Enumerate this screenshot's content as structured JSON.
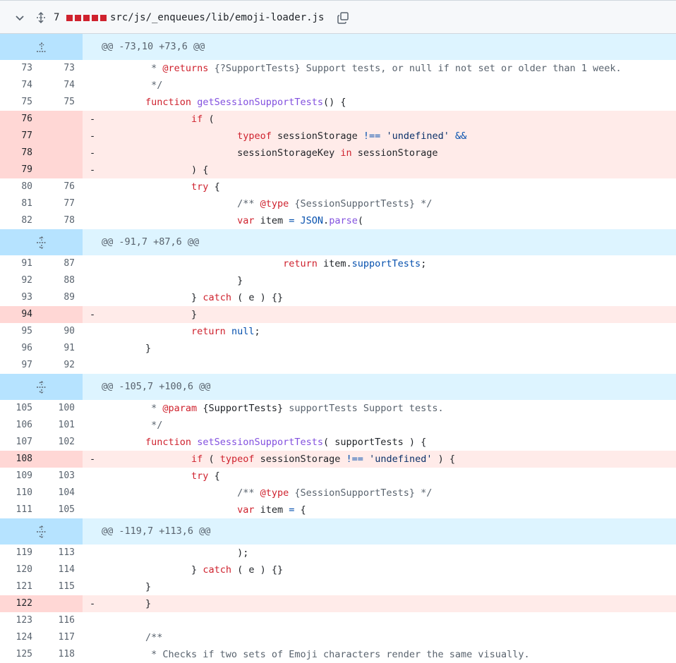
{
  "file": {
    "change_count": "7",
    "path": "src/js/_enqueues/lib/emoji-loader.js"
  },
  "colors": {
    "deleted_block": "#cf222e",
    "hunk_bg": "#ddf4ff",
    "del_bg": "#ffebe9"
  },
  "rows": [
    {
      "type": "hunk",
      "text": "@@ -73,10 +73,6 @@",
      "icon": "expand-up-icon"
    },
    {
      "type": "ctx",
      "old": "73",
      "new": "73",
      "tokens": [
        [
          "c",
          "         * "
        ],
        [
          "kw",
          "@returns"
        ],
        [
          "c",
          " {?SupportTests} Support tests, or null if not set or older than 1 week."
        ]
      ]
    },
    {
      "type": "ctx",
      "old": "74",
      "new": "74",
      "tokens": [
        [
          "c",
          "         */"
        ]
      ]
    },
    {
      "type": "ctx",
      "old": "75",
      "new": "75",
      "tokens": [
        [
          "t",
          "        "
        ],
        [
          "kw",
          "function"
        ],
        [
          "t",
          " "
        ],
        [
          "fn",
          "getSessionSupportTests"
        ],
        [
          "t",
          "() {"
        ]
      ]
    },
    {
      "type": "del",
      "old": "76",
      "tokens": [
        [
          "t",
          "                "
        ],
        [
          "kw",
          "if"
        ],
        [
          "t",
          " ("
        ]
      ]
    },
    {
      "type": "del",
      "old": "77",
      "tokens": [
        [
          "t",
          "                        "
        ],
        [
          "kw",
          "typeof"
        ],
        [
          "t",
          " sessionStorage "
        ],
        [
          "op",
          "!=="
        ],
        [
          "t",
          " "
        ],
        [
          "str",
          "'undefined'"
        ],
        [
          "t",
          " "
        ],
        [
          "op",
          "&&"
        ]
      ]
    },
    {
      "type": "del",
      "old": "78",
      "tokens": [
        [
          "t",
          "                        sessionStorageKey "
        ],
        [
          "kw",
          "in"
        ],
        [
          "t",
          " sessionStorage"
        ]
      ]
    },
    {
      "type": "del",
      "old": "79",
      "tokens": [
        [
          "t",
          "                ) {"
        ]
      ]
    },
    {
      "type": "ctx",
      "old": "80",
      "new": "76",
      "tokens": [
        [
          "t",
          "                "
        ],
        [
          "kw",
          "try"
        ],
        [
          "t",
          " {"
        ]
      ]
    },
    {
      "type": "ctx",
      "old": "81",
      "new": "77",
      "tokens": [
        [
          "c",
          "                        /** "
        ],
        [
          "kw",
          "@type"
        ],
        [
          "c",
          " {SessionSupportTests} */"
        ]
      ]
    },
    {
      "type": "ctx",
      "old": "82",
      "new": "78",
      "tokens": [
        [
          "t",
          "                        "
        ],
        [
          "kw",
          "var"
        ],
        [
          "t",
          " item "
        ],
        [
          "op",
          "="
        ],
        [
          "t",
          " "
        ],
        [
          "ent",
          "JSON"
        ],
        [
          "t",
          "."
        ],
        [
          "fn",
          "parse"
        ],
        [
          "t",
          "("
        ]
      ]
    },
    {
      "type": "hunk",
      "text": "@@ -91,7 +87,6 @@",
      "icon": "expand-both-icon"
    },
    {
      "type": "ctx",
      "old": "91",
      "new": "87",
      "tokens": [
        [
          "t",
          "                                "
        ],
        [
          "kw",
          "return"
        ],
        [
          "t",
          " item."
        ],
        [
          "ent",
          "supportTests"
        ],
        [
          "t",
          ";"
        ]
      ]
    },
    {
      "type": "ctx",
      "old": "92",
      "new": "88",
      "tokens": [
        [
          "t",
          "                        }"
        ]
      ]
    },
    {
      "type": "ctx",
      "old": "93",
      "new": "89",
      "tokens": [
        [
          "t",
          "                } "
        ],
        [
          "kw",
          "catch"
        ],
        [
          "t",
          " ( e ) {}"
        ]
      ]
    },
    {
      "type": "del",
      "old": "94",
      "tokens": [
        [
          "t",
          "                }"
        ]
      ]
    },
    {
      "type": "ctx",
      "old": "95",
      "new": "90",
      "tokens": [
        [
          "t",
          "                "
        ],
        [
          "kw",
          "return"
        ],
        [
          "t",
          " "
        ],
        [
          "ent",
          "null"
        ],
        [
          "t",
          ";"
        ]
      ]
    },
    {
      "type": "ctx",
      "old": "96",
      "new": "91",
      "tokens": [
        [
          "t",
          "        }"
        ]
      ]
    },
    {
      "type": "ctx",
      "old": "97",
      "new": "92",
      "tokens": [
        [
          "t",
          ""
        ]
      ]
    },
    {
      "type": "hunk",
      "text": "@@ -105,7 +100,6 @@",
      "icon": "expand-both-icon"
    },
    {
      "type": "ctx",
      "old": "105",
      "new": "100",
      "tokens": [
        [
          "c",
          "         * "
        ],
        [
          "kw",
          "@param"
        ],
        [
          "t",
          " {SupportTests}"
        ],
        [
          "c",
          " supportTests Support tests."
        ]
      ]
    },
    {
      "type": "ctx",
      "old": "106",
      "new": "101",
      "tokens": [
        [
          "c",
          "         */"
        ]
      ]
    },
    {
      "type": "ctx",
      "old": "107",
      "new": "102",
      "tokens": [
        [
          "t",
          "        "
        ],
        [
          "kw",
          "function"
        ],
        [
          "t",
          " "
        ],
        [
          "fn",
          "setSessionSupportTests"
        ],
        [
          "t",
          "( supportTests ) {"
        ]
      ]
    },
    {
      "type": "del",
      "old": "108",
      "tokens": [
        [
          "t",
          "                "
        ],
        [
          "kw",
          "if"
        ],
        [
          "t",
          " ( "
        ],
        [
          "kw",
          "typeof"
        ],
        [
          "t",
          " sessionStorage "
        ],
        [
          "op",
          "!=="
        ],
        [
          "t",
          " "
        ],
        [
          "str",
          "'undefined'"
        ],
        [
          "t",
          " ) {"
        ]
      ]
    },
    {
      "type": "ctx",
      "old": "109",
      "new": "103",
      "tokens": [
        [
          "t",
          "                "
        ],
        [
          "kw",
          "try"
        ],
        [
          "t",
          " {"
        ]
      ]
    },
    {
      "type": "ctx",
      "old": "110",
      "new": "104",
      "tokens": [
        [
          "c",
          "                        /** "
        ],
        [
          "kw",
          "@type"
        ],
        [
          "c",
          " {SessionSupportTests} */"
        ]
      ]
    },
    {
      "type": "ctx",
      "old": "111",
      "new": "105",
      "tokens": [
        [
          "t",
          "                        "
        ],
        [
          "kw",
          "var"
        ],
        [
          "t",
          " item "
        ],
        [
          "op",
          "="
        ],
        [
          "t",
          " {"
        ]
      ]
    },
    {
      "type": "hunk",
      "text": "@@ -119,7 +113,6 @@",
      "icon": "expand-both-icon"
    },
    {
      "type": "ctx",
      "old": "119",
      "new": "113",
      "tokens": [
        [
          "t",
          "                        );"
        ]
      ]
    },
    {
      "type": "ctx",
      "old": "120",
      "new": "114",
      "tokens": [
        [
          "t",
          "                } "
        ],
        [
          "kw",
          "catch"
        ],
        [
          "t",
          " ( e ) {}"
        ]
      ]
    },
    {
      "type": "ctx",
      "old": "121",
      "new": "115",
      "tokens": [
        [
          "t",
          "        }"
        ]
      ]
    },
    {
      "type": "del",
      "old": "122",
      "tokens": [
        [
          "t",
          "        }"
        ]
      ]
    },
    {
      "type": "ctx",
      "old": "123",
      "new": "116",
      "tokens": [
        [
          "t",
          ""
        ]
      ]
    },
    {
      "type": "ctx",
      "old": "124",
      "new": "117",
      "tokens": [
        [
          "c",
          "        /**"
        ]
      ]
    },
    {
      "type": "ctx",
      "old": "125",
      "new": "118",
      "tokens": [
        [
          "c",
          "         * Checks if two sets of Emoji characters render the same visually."
        ]
      ]
    }
  ]
}
